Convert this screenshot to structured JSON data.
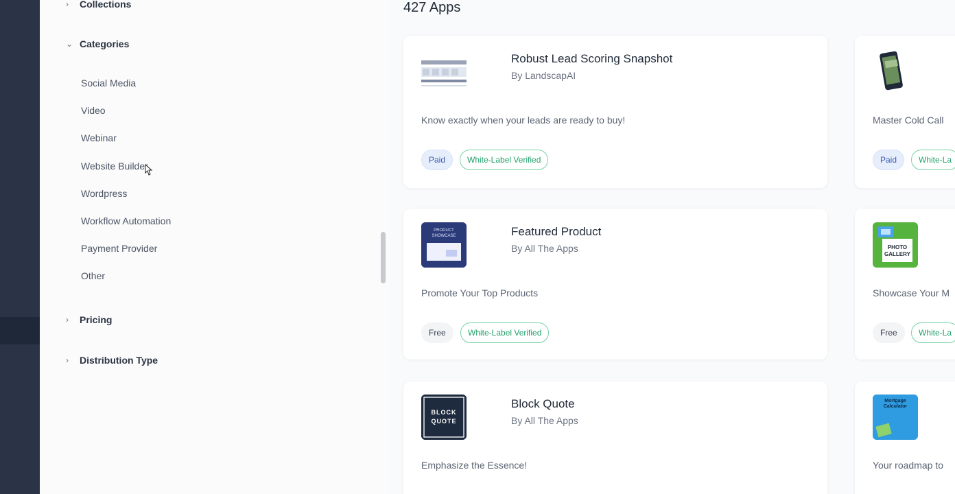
{
  "filters": {
    "collections_label": "Collections",
    "categories_label": "Categories",
    "categories": [
      "Social Media",
      "Video",
      "Webinar",
      "Website Builder",
      "Wordpress",
      "Workflow Automation",
      "Payment Provider",
      "Other"
    ],
    "pricing_label": "Pricing",
    "distribution_label": "Distribution Type"
  },
  "main": {
    "count": "427 Apps",
    "apps": [
      {
        "title": "Robust Lead Scoring Snapshot",
        "by": "By LandscapAI",
        "description": "Know exactly when your leads are ready to buy!",
        "price": "Paid",
        "badge": "White-Label Verified"
      },
      {
        "title": "",
        "by": "",
        "description": "Master Cold Call",
        "price": "Paid",
        "badge": "White-La"
      },
      {
        "title": "Featured Product",
        "by": "By All The Apps",
        "description": "Promote Your Top Products",
        "price": "Free",
        "badge": "White-Label Verified",
        "thumb_text": "PRODUCT SHOWCASE"
      },
      {
        "title": "",
        "by": "",
        "description": "Showcase Your M",
        "price": "Free",
        "badge": "White-La",
        "thumb_text": "PHOTO GALLERY"
      },
      {
        "title": "Block Quote",
        "by": "By All The Apps",
        "description": "Emphasize the Essence!",
        "thumb_text": "BLOCK QUOTE"
      },
      {
        "title": "",
        "by": "",
        "description": "Your roadmap to",
        "thumb_text": "Mortgage Calculator"
      }
    ]
  },
  "colors": {
    "rail": "#2a3446",
    "badge_green": "#22a06b",
    "paid_blue": "#3b5bb5"
  }
}
